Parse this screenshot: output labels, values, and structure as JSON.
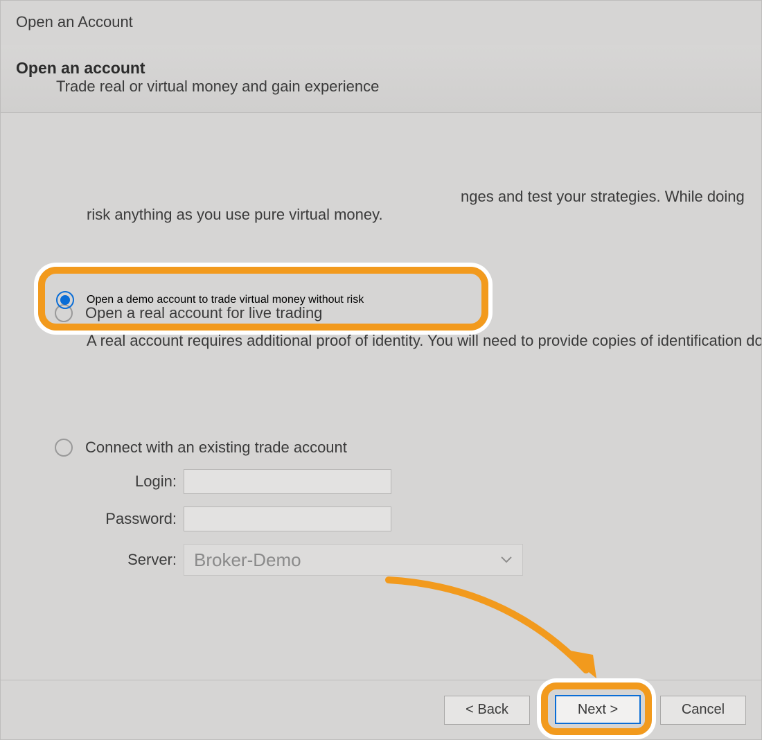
{
  "window": {
    "title": "Open an Account"
  },
  "header": {
    "heading": "Open an account",
    "subheading": "Trade real or virtual money and gain experience"
  },
  "options": {
    "demo": {
      "label": "Open a demo account to trade virtual money without risk",
      "description_tail": "nges and test your strategies. While doing",
      "description_line2": "risk anything as you use pure virtual money.",
      "selected": true
    },
    "real": {
      "label": "Open a real account for live trading",
      "description": "A real account requires additional proof of identity. You will need to provide copies of identification do",
      "selected": false
    },
    "existing": {
      "label": "Connect with an existing trade account",
      "selected": false,
      "fields": {
        "login_label": "Login:",
        "login_value": "",
        "password_label": "Password:",
        "password_value": "",
        "server_label": "Server:",
        "server_value": "Broker-Demo"
      }
    }
  },
  "footer": {
    "back_label": "< Back",
    "next_label": "Next >",
    "cancel_label": "Cancel"
  },
  "colors": {
    "highlight": "#f29a1d",
    "accent": "#0a6dd6"
  }
}
